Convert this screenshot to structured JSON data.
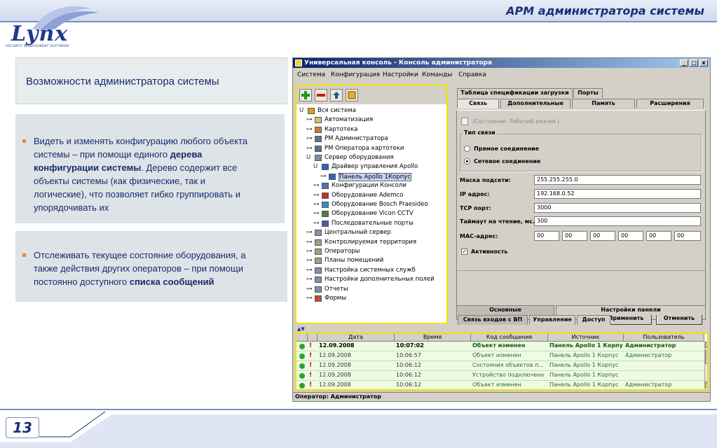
{
  "header": {
    "title": "АРМ администратора системы"
  },
  "logo": {
    "word": "Lynx",
    "tagline": "SECURITY MANAGEMENT SOFTWARE"
  },
  "slide": {
    "title": "Возможности администратора системы",
    "point1": {
      "line1": "Видеть и изменять конфигурацию любого объекта",
      "line2_a": "системы – при помощи единого ",
      "line2_b": "дерева",
      "line3_a": "конфигурации системы",
      "line3_b": ". Дерево содержит все",
      "line4": "объекты системы (как физические, так и",
      "line5": "логические), что позволяет гибко группировать и",
      "line6": "упорядочивать их"
    },
    "point2": {
      "line1": "Отслеживать текущее состояние оборудования, а",
      "line2": "также действия других операторов – при помощи",
      "line3_a": "постоянно доступного ",
      "line3_b": "списка сообщений"
    }
  },
  "window": {
    "title": "Универсальная консоль - Консоль администратора",
    "minimize": "_",
    "maximize": "□",
    "close": "x",
    "menu": [
      "Система",
      "Конфигурация",
      "Настройки",
      "Команды",
      "Справка"
    ]
  },
  "tree": [
    {
      "label": "Вся система",
      "icon": "globe-icon",
      "color": "#d9a020"
    },
    {
      "label": "Автоматизация",
      "icon": "folder-icon",
      "color": "#d8c070"
    },
    {
      "label": "Картотека",
      "icon": "cards-icon",
      "color": "#c08030"
    },
    {
      "label": "РМ Администратора",
      "icon": "computer-icon",
      "color": "#607090"
    },
    {
      "label": "РМ Оператора картотеки",
      "icon": "computer-icon",
      "color": "#607090"
    },
    {
      "label": "Сервер оборудования",
      "icon": "server-icon",
      "color": "#8090a8"
    },
    {
      "label": "Драйвер управления Apollo",
      "icon": "driver-icon",
      "color": "#3060c0"
    },
    {
      "label": "Панель Apollo 1Корпус",
      "icon": "panel-icon",
      "color": "#3060c0"
    },
    {
      "label": "Конфигурации Консоли",
      "icon": "config-icon",
      "color": "#5070b0"
    },
    {
      "label": "Оборудование Ademco",
      "icon": "device-icon",
      "color": "#c03030"
    },
    {
      "label": "Оборудование Bosch Praesideo",
      "icon": "device-icon",
      "color": "#3090c0"
    },
    {
      "label": "Оборудование Vicon CCTV",
      "icon": "camera-icon",
      "color": "#508030"
    },
    {
      "label": "Последовательные порты",
      "icon": "port-icon",
      "color": "#4060a0"
    },
    {
      "label": "Центральный сервер",
      "icon": "server-icon",
      "color": "#8090a8"
    },
    {
      "label": "Контролируемая территория",
      "icon": "territory-icon",
      "color": "#a0a080"
    },
    {
      "label": "Операторы",
      "icon": "users-icon",
      "color": "#a0a080"
    },
    {
      "label": "Планы помещений",
      "icon": "plan-icon",
      "color": "#a0a080"
    },
    {
      "label": "Настройка системных служб",
      "icon": "services-icon",
      "color": "#8090a8"
    },
    {
      "label": "Настройки дополнительных полей",
      "icon": "fields-icon",
      "color": "#8090a8"
    },
    {
      "label": "Отчеты",
      "icon": "report-icon",
      "color": "#8090a8"
    },
    {
      "label": "Формы",
      "icon": "forms-icon",
      "color": "#c05030"
    }
  ],
  "tabs": {
    "row1": [
      "Таблица спецификации загрузки",
      "Порты"
    ],
    "row2": [
      "Связь",
      "Дополнительные",
      "Память",
      "Расширения"
    ],
    "state": "(Состояние: Рабочий режим )",
    "conn_group": "Тип связи",
    "radio1": "Прямое соединение",
    "radio2": "Сетевое соединение",
    "fields": [
      {
        "label": "Маска подсети:",
        "value": "255.255.255.0"
      },
      {
        "label": "IP адрес:",
        "value": "192.168.0.52"
      },
      {
        "label": "TCP порт:",
        "value": "3000"
      },
      {
        "label": "Таймаут на чтение, мс.:",
        "value": "300"
      }
    ],
    "mac_label": "MAC-адрес:",
    "mac": [
      "00",
      "00",
      "00",
      "00",
      "00",
      "00"
    ],
    "active": "Активность",
    "apply": "Применить",
    "cancel": "Отменить",
    "bottom1": [
      "Основные",
      "Настройки панели"
    ],
    "bottom2": [
      "Связь входов с ВП",
      "Управление",
      "Доступ"
    ]
  },
  "log": {
    "columns": [
      "Дата",
      "Время",
      "Код сообщения",
      "Источник",
      "Пользователь"
    ],
    "rows": [
      [
        "12.09.2008",
        "10:07:02",
        "Объект изменен",
        "Панель Apollo 1 Корпус",
        "Администратор"
      ],
      [
        "12.09.2008",
        "10:06:57",
        "Объект изменен",
        "Панель Apollo 1 Корпус",
        "Администратор"
      ],
      [
        "12.09.2008",
        "10:06:12",
        "Состояния объектов п...",
        "Панель Apollo 1 Корпус",
        ""
      ],
      [
        "12.09.2008",
        "10:06:12",
        "Устройство подключено",
        "Панель Apollo 1 Корпус",
        ""
      ],
      [
        "12.09.2008",
        "10:06:12",
        "Объект изменен",
        "Панель Apollo 1 Корпус",
        "Администратор"
      ]
    ]
  },
  "status": "Оператор: Администратор",
  "footer": {
    "page": "13"
  }
}
